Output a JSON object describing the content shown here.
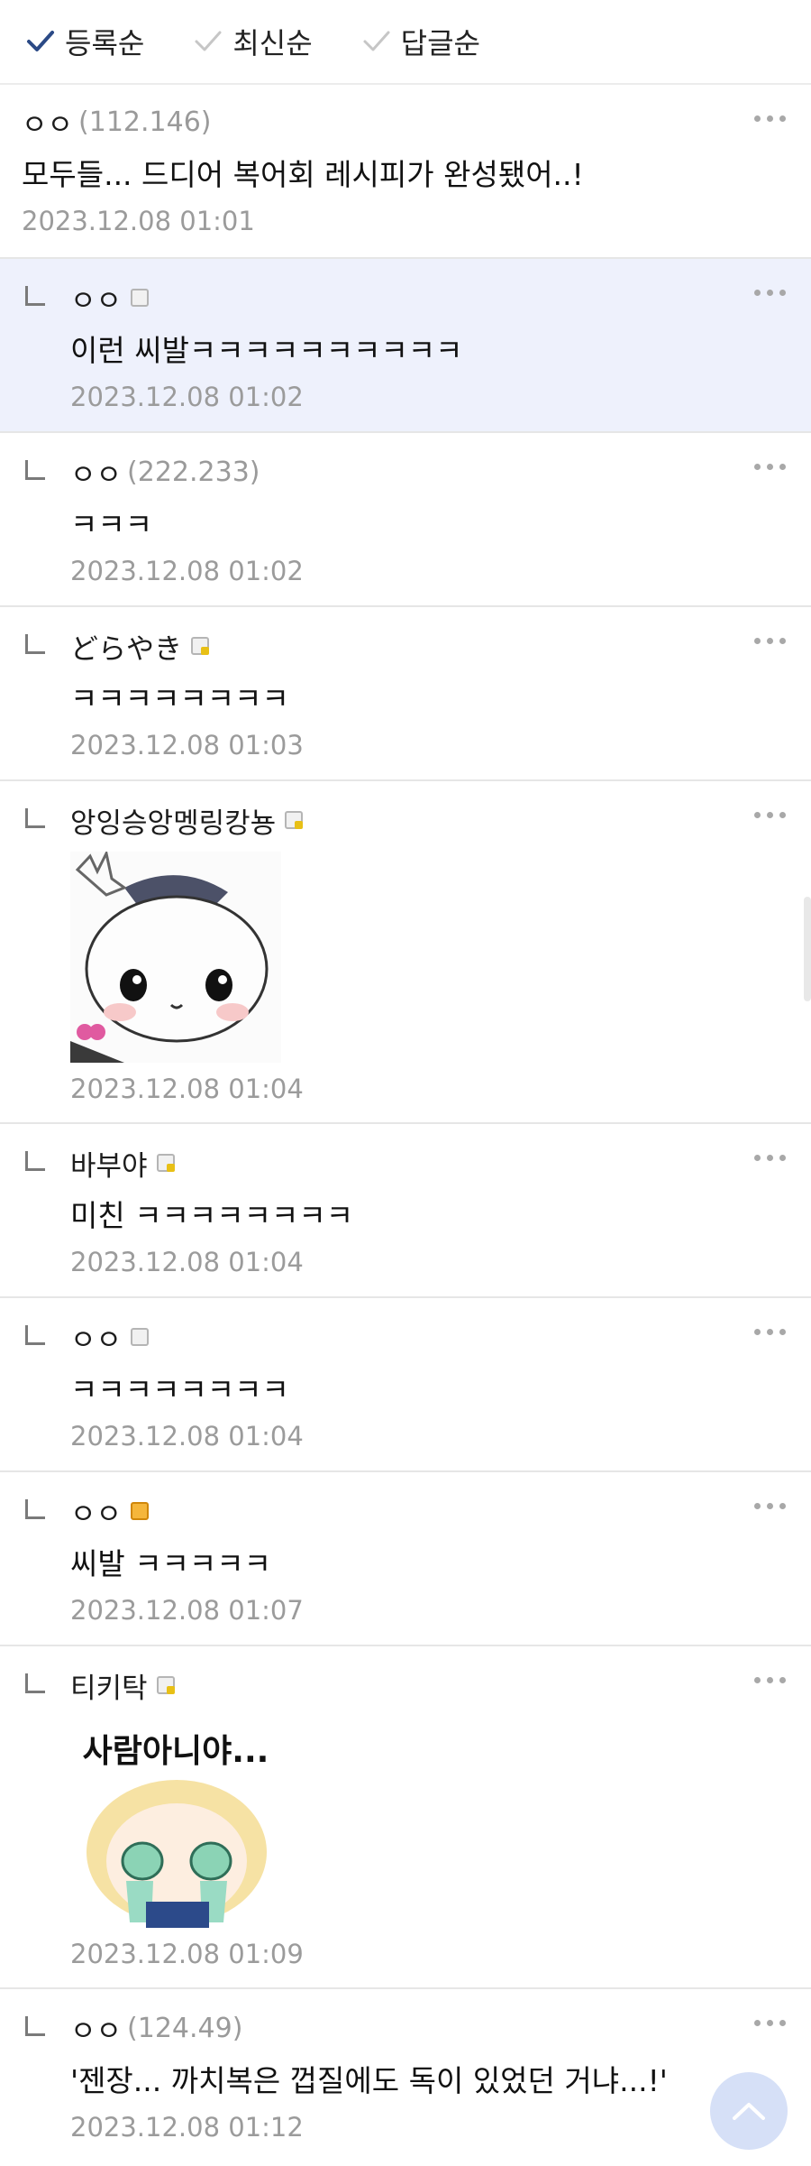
{
  "sort": {
    "options": [
      {
        "label": "등록순",
        "active": true
      },
      {
        "label": "최신순",
        "active": false
      },
      {
        "label": "답글순",
        "active": false
      }
    ]
  },
  "comments": [
    {
      "nick": "ㅇㅇ",
      "ip": "(112.146)",
      "text": "모두들... 드디어 복어회 레시피가 완성됐어..!",
      "date": "2023.12.08 01:01"
    },
    {
      "nick": "ㅇㅇ",
      "text": "이런 씨발ㅋㅋㅋㅋㅋㅋㅋㅋㅋㅋ",
      "date": "2023.12.08 01:02"
    },
    {
      "nick": "ㅇㅇ",
      "ip": "(222.233)",
      "text": "ㅋㅋㅋ",
      "date": "2023.12.08 01:02"
    },
    {
      "nick": "どらやき",
      "text": "ㅋㅋㅋㅋㅋㅋㅋㅋ",
      "date": "2023.12.08 01:03"
    },
    {
      "nick": "앙잉승앙멩링캉뇽",
      "date": "2023.12.08 01:04"
    },
    {
      "nick": "바부야",
      "text": "미친 ㅋㅋㅋㅋㅋㅋㅋㅋ",
      "date": "2023.12.08 01:04"
    },
    {
      "nick": "ㅇㅇ",
      "text": "ㅋㅋㅋㅋㅋㅋㅋㅋ",
      "date": "2023.12.08 01:04"
    },
    {
      "nick": "ㅇㅇ",
      "text": "씨발 ㅋㅋㅋㅋㅋ",
      "date": "2023.12.08 01:07"
    },
    {
      "nick": "티키탁",
      "sticker_text": "사람아니야...",
      "date": "2023.12.08 01:09"
    },
    {
      "nick": "ㅇㅇ",
      "ip": "(124.49)",
      "text": "'젠장... 까치복은 껍질에도 독이 있었던 거냐...!'",
      "date": "2023.12.08 01:12"
    }
  ],
  "colors": {
    "highlight": "#eef1fc",
    "date": "#9b9b9b",
    "ip": "#9a9a9a",
    "top_button": "#d6e0f7"
  },
  "icons": {
    "check": "check-icon",
    "more": "more-dots-icon",
    "reply": "reply-arrow-icon",
    "badge": "gallery-badge-icon",
    "top": "scroll-top-icon"
  }
}
